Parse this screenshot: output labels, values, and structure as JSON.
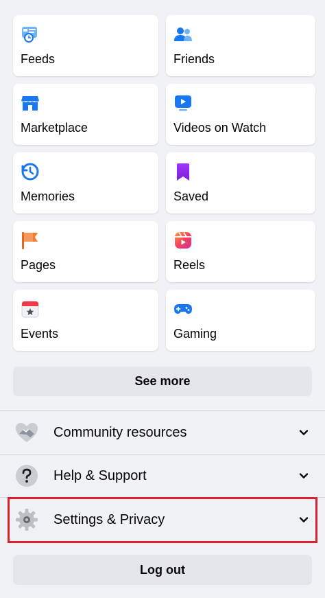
{
  "shortcuts": [
    {
      "label": "Feeds",
      "icon": "feeds-icon"
    },
    {
      "label": "Friends",
      "icon": "friends-icon"
    },
    {
      "label": "Marketplace",
      "icon": "marketplace-icon"
    },
    {
      "label": "Videos on Watch",
      "icon": "watch-video-icon"
    },
    {
      "label": "Memories",
      "icon": "memories-clock-icon"
    },
    {
      "label": "Saved",
      "icon": "saved-bookmark-icon"
    },
    {
      "label": "Pages",
      "icon": "pages-flag-icon"
    },
    {
      "label": "Reels",
      "icon": "reels-icon"
    },
    {
      "label": "Events",
      "icon": "events-calendar-icon"
    },
    {
      "label": "Gaming",
      "icon": "gaming-controller-icon"
    }
  ],
  "see_more_label": "See more",
  "sections": [
    {
      "label": "Community resources",
      "icon": "handshake-icon"
    },
    {
      "label": "Help & Support",
      "icon": "question-icon"
    },
    {
      "label": "Settings & Privacy",
      "icon": "gear-icon"
    }
  ],
  "logout_label": "Log out",
  "colors": {
    "background": "#f0f2f5",
    "tile": "#ffffff",
    "button": "#e4e6eb",
    "highlight": "#e0202a",
    "brand_blue": "#1877f2"
  }
}
